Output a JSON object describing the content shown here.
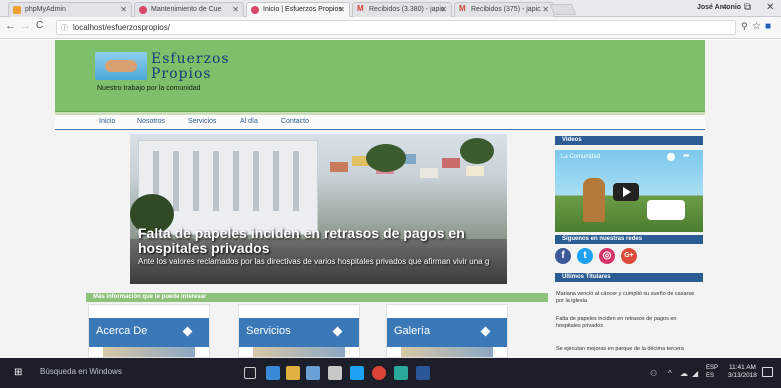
{
  "browser": {
    "tabs": [
      {
        "label": "phpMyAdmin",
        "active": false,
        "favicon_color": "#f0a030"
      },
      {
        "label": "Mantenimiento de Cue",
        "active": false,
        "favicon_color": "#d9476b"
      },
      {
        "label": "Inicio | Esfuerzos Propios",
        "active": true,
        "favicon_color": "#d9476b"
      },
      {
        "label": "Recibidos (3.380) - japic",
        "active": false,
        "favicon_color": "#d44638"
      },
      {
        "label": "Recibidos (375) - japic",
        "active": false,
        "favicon_color": "#d44638"
      }
    ],
    "user": "José Antonio",
    "url": "localhost/esfuerzospropios/"
  },
  "site": {
    "brand_line1": "Esfuerzos",
    "brand_line2": "Propios",
    "tagline": "Nuestro trabajo por la comunidad",
    "menu": [
      "Inicio",
      "Nosotros",
      "Servicios",
      "Al día",
      "Contacto"
    ],
    "slider": {
      "headline": "Falta de papeles inciden en retrasos de pagos en hospitales privados",
      "subtext": "Ante los valores reclamados por las directivas de varios hospitales privados que afirman vivir una g"
    },
    "sidebar": {
      "videos_title": "Videos",
      "video_label": "La Comunidad",
      "social_title": "Síguenos en nuestras redes",
      "social": [
        {
          "icon": "facebook-icon",
          "glyph": "f",
          "color": "#3b5998"
        },
        {
          "icon": "twitter-icon",
          "glyph": "t",
          "color": "#1da1f2"
        },
        {
          "icon": "instagram-icon",
          "glyph": "◎",
          "color": "#d6336c"
        },
        {
          "icon": "googleplus-icon",
          "glyph": "G+",
          "color": "#dd4b39"
        }
      ],
      "titulares_title": "Últimos Titulares",
      "titulares": [
        "Mariana venció al cáncer y cumplió su sueño de casarse por la iglesia",
        "Falta de papeles inciden en retrasos de pagos en hospitales privados",
        "Se ejecutan mejoras en parque de la décima tercera"
      ]
    },
    "more_info": "Más información que te puede interesar",
    "cards": [
      "Acerca De",
      "Servicios",
      "Galería"
    ]
  },
  "taskbar": {
    "search_placeholder": "Búsqueda en Windows",
    "lang_top": "ESP",
    "lang_bottom": "ES",
    "time": "11:41 AM",
    "date": "3/13/2018"
  }
}
